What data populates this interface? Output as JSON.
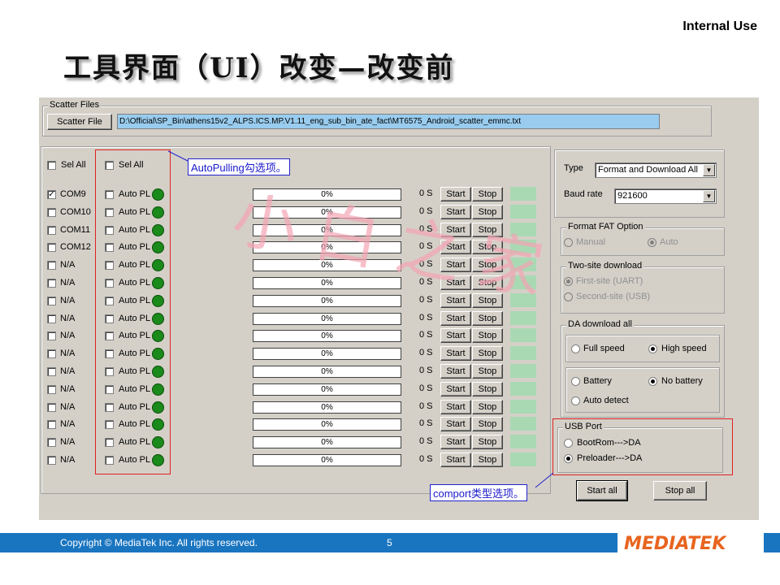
{
  "header": {
    "internal_use": "Internal Use",
    "title": "工具界面（UI）改变—改变前"
  },
  "scatter": {
    "group_label": "Scatter Files",
    "button": "Scatter File",
    "path": "D:\\Official\\SP_Bin\\athens15v2_ALPS.ICS.MP.V1.11_eng_sub_bin_ate_fact\\MT6575_Android_scatter_emmc.txt"
  },
  "ports": {
    "sel_all": "Sel All",
    "sel_all_auto": "Sel All",
    "auto_label": "Auto PL",
    "start_label": "Start",
    "stop_label": "Stop",
    "rows": [
      {
        "name": "COM9",
        "checked": true,
        "progress": "0%",
        "time": "0 S"
      },
      {
        "name": "COM10",
        "checked": false,
        "progress": "0%",
        "time": "0 S"
      },
      {
        "name": "COM11",
        "checked": false,
        "progress": "0%",
        "time": "0 S"
      },
      {
        "name": "COM12",
        "checked": false,
        "progress": "0%",
        "time": "0 S"
      },
      {
        "name": "N/A",
        "checked": false,
        "progress": "0%",
        "time": "0 S"
      },
      {
        "name": "N/A",
        "checked": false,
        "progress": "0%",
        "time": "0 S"
      },
      {
        "name": "N/A",
        "checked": false,
        "progress": "0%",
        "time": "0 S"
      },
      {
        "name": "N/A",
        "checked": false,
        "progress": "0%",
        "time": "0 S"
      },
      {
        "name": "N/A",
        "checked": false,
        "progress": "0%",
        "time": "0 S"
      },
      {
        "name": "N/A",
        "checked": false,
        "progress": "0%",
        "time": "0 S"
      },
      {
        "name": "N/A",
        "checked": false,
        "progress": "0%",
        "time": "0 S"
      },
      {
        "name": "N/A",
        "checked": false,
        "progress": "0%",
        "time": "0 S"
      },
      {
        "name": "N/A",
        "checked": false,
        "progress": "0%",
        "time": "0 S"
      },
      {
        "name": "N/A",
        "checked": false,
        "progress": "0%",
        "time": "0 S"
      },
      {
        "name": "N/A",
        "checked": false,
        "progress": "0%",
        "time": "0 S"
      },
      {
        "name": "N/A",
        "checked": false,
        "progress": "0%",
        "time": "0 S"
      }
    ]
  },
  "settings": {
    "type_label": "Type",
    "type_value": "Format and Download All",
    "baud_label": "Baud rate",
    "baud_value": "921600",
    "format_fat": {
      "label": "Format FAT Option",
      "manual": "Manual",
      "auto": "Auto"
    },
    "two_site": {
      "label": "Two-site download",
      "first": "First-site (UART)",
      "second": "Second-site (USB)"
    },
    "da": {
      "label": "DA download all",
      "full": "Full speed",
      "high": "High speed",
      "battery": "Battery",
      "no_battery": "No battery",
      "auto_detect": "Auto detect"
    },
    "usb": {
      "label": "USB Port",
      "bootrom": "BootRom--->DA",
      "preloader": "Preloader--->DA"
    },
    "start_all": "Start all",
    "stop_all": "Stop all"
  },
  "annotations": {
    "autopulling": "AutoPulling勾选项。",
    "comport": "comport类型选项。"
  },
  "watermark": {
    "text": "小白之家"
  },
  "footer": {
    "copyright": "Copyright © MediaTek Inc. All rights reserved.",
    "page": "5",
    "logo": "MEDIATEK"
  },
  "colors": {
    "footer_bar": "#1a75c0",
    "logo_orange": "#e8641e",
    "led_green": "#1a8a1a",
    "annotation_red": "#e02020",
    "annotation_blue": "#1a1acc"
  }
}
